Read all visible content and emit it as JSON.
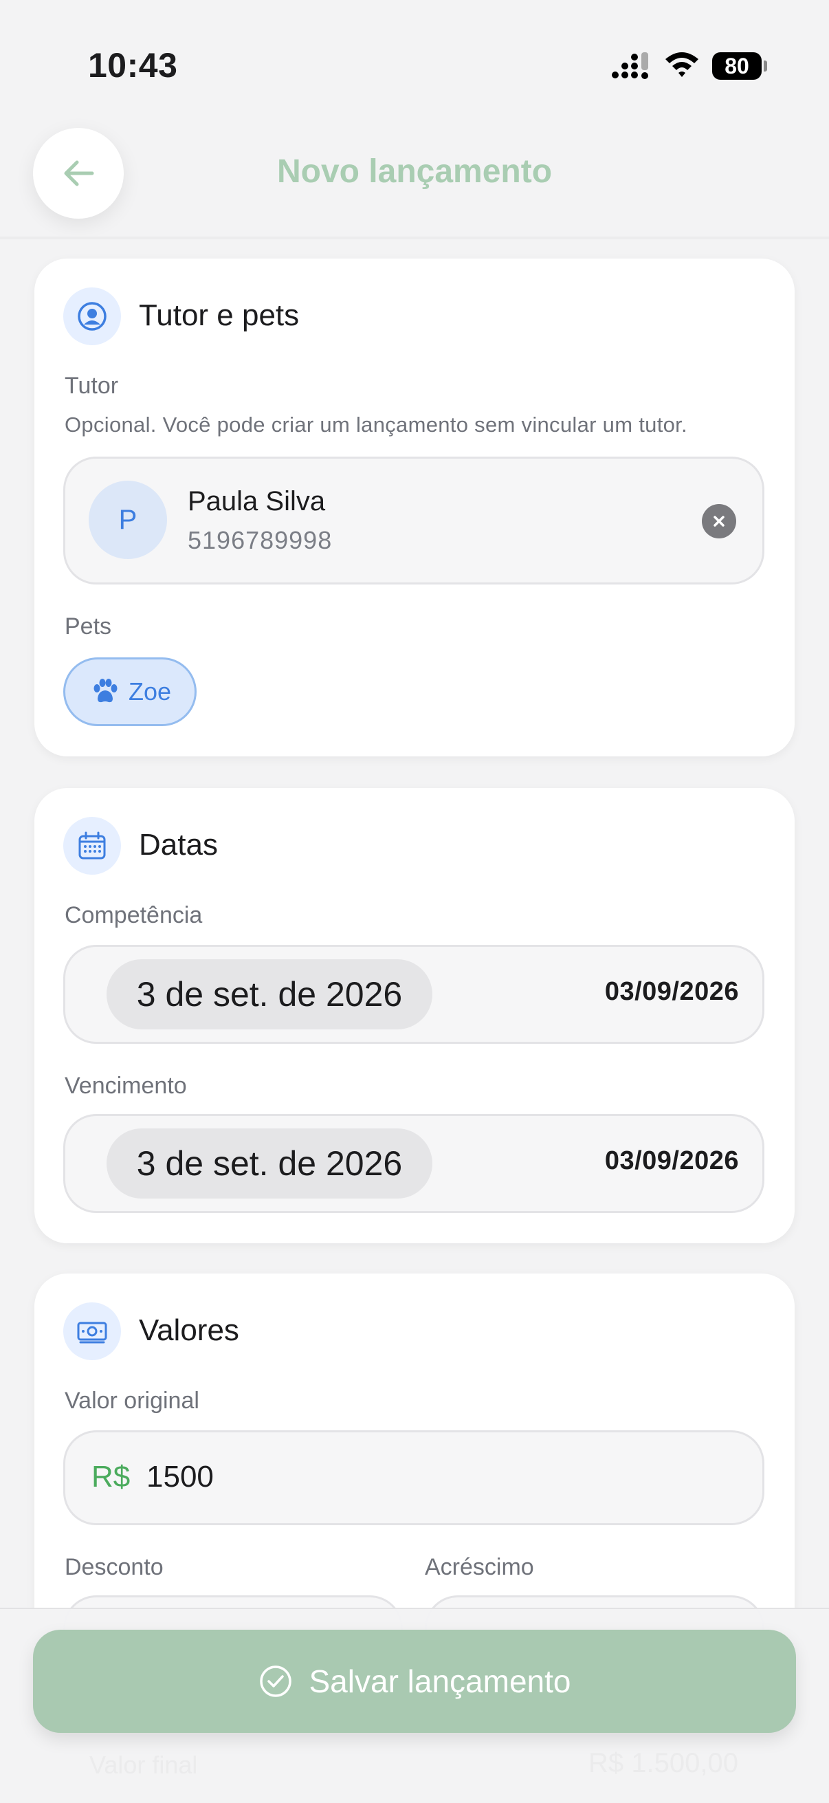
{
  "status_bar": {
    "time": "10:43",
    "battery": "80"
  },
  "header": {
    "title": "Novo lançamento",
    "back_icon": "arrow-left-icon"
  },
  "tutor_section": {
    "title": "Tutor e pets",
    "icon": "person-circle-icon",
    "tutor_label": "Tutor",
    "tutor_help": "Opcional. Você pode criar um lançamento sem vincular um tutor.",
    "selected_tutor": {
      "initial": "P",
      "name": "Paula Silva",
      "phone": "5196789998"
    },
    "pets_label": "Pets",
    "pets": [
      {
        "name": "Zoe",
        "icon": "paw-icon"
      }
    ]
  },
  "dates_section": {
    "title": "Datas",
    "icon": "calendar-icon",
    "competencia": {
      "label": "Competência",
      "display": "3 de set. de 2026",
      "value": "03/09/2026"
    },
    "vencimento": {
      "label": "Vencimento",
      "display": "3 de set. de 2026",
      "value": "03/09/2026"
    }
  },
  "values_section": {
    "title": "Valores",
    "icon": "banknote-icon",
    "original": {
      "label": "Valor original",
      "currency": "R$",
      "value": "1500"
    },
    "desconto_label": "Desconto",
    "acrescimo_label": "Acréscimo"
  },
  "footer": {
    "final_label": "Valor final",
    "final_value": "R$ 1.500,00",
    "save_label": "Salvar lançamento",
    "save_icon": "check-circle-icon"
  },
  "colors": {
    "accent_blue": "#3d7ee0",
    "accent_green": "#4bab5d",
    "button_green": "#a9c9b1",
    "title_green": "#a9cdb2"
  }
}
